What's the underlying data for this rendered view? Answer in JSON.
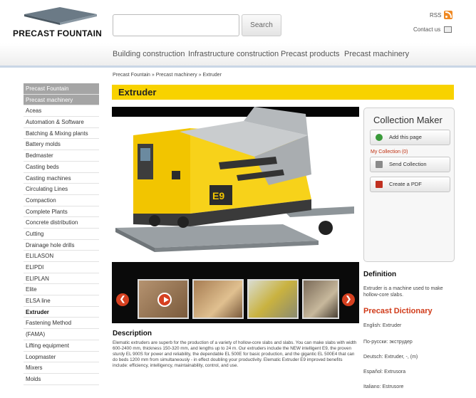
{
  "header": {
    "logo_text": "PRECAST FOUNTAIN",
    "search_placeholder": "",
    "search_button": "Search",
    "rss_label": "RSS",
    "contact_label": "Contact us"
  },
  "nav": {
    "items": [
      "Building construction",
      "Infrastructure construction",
      "Precast products",
      "Precast machinery"
    ]
  },
  "breadcrumb": "Precast Fountain » Precast machinery » Extruder",
  "sidebar": {
    "items": [
      "Precast Fountain",
      "Precast machinery",
      "Aceas",
      "Automation & Software",
      "Batching & Mixing plants",
      "Battery molds",
      "Bedmaster",
      "Casting beds",
      "Casting machines",
      "Circulating Lines",
      "Compaction",
      "Complete Plants",
      "Concrete distribution",
      "Cutting",
      "Drainage hole drills",
      "ELILASON",
      "ELIPDI",
      "ELIPLAN",
      "Elite",
      "ELSA line",
      "Extruder",
      "Fastening Method",
      "(FAMA)",
      "Lifting equipment",
      "Loopmaster",
      "Mixers",
      "Molds"
    ]
  },
  "main": {
    "title": "Extruder",
    "desc_title": "Description",
    "desc_text": "Elematic extruders are superb for the production of a variety of hollow-core slabs and slabs. You can make slabs with width 600-2400 mm, thickness 150-320 mm, and lengths up to 24 m. Our extruders include the NEW intelligent E9, the proven sturdy EL 900S for power and reliability, the dependable EL 500E for basic production, and the gigantic EL 500E4 that can do beds 1200 mm from simultaneously - in effect doubling your productivity. Elematic Extruder E9 improved benefits include: efficiency, intelligency, maintainability, control, and use."
  },
  "collection": {
    "title": "Collection Maker",
    "add_label": "Add this page",
    "my_collection": "My Collection (0)",
    "send_label": "Send Collection",
    "pdf_label": "Create a PDF"
  },
  "definition": {
    "title": "Definition",
    "text": "Extruder is a machine used to make hollow-core slabs.",
    "dict_title": "Precast Dictionary",
    "dict_items": [
      "English: Extruder",
      "По-русски: экструдер",
      "Deutsch: Extruder, -, (m)",
      "Español: Extrusora",
      "Italiano: Estrusore"
    ]
  },
  "colors": {
    "title_bar": "#f8d200",
    "accent_red": "#d03a18",
    "sidebar_grey": "#a5a5a5"
  }
}
